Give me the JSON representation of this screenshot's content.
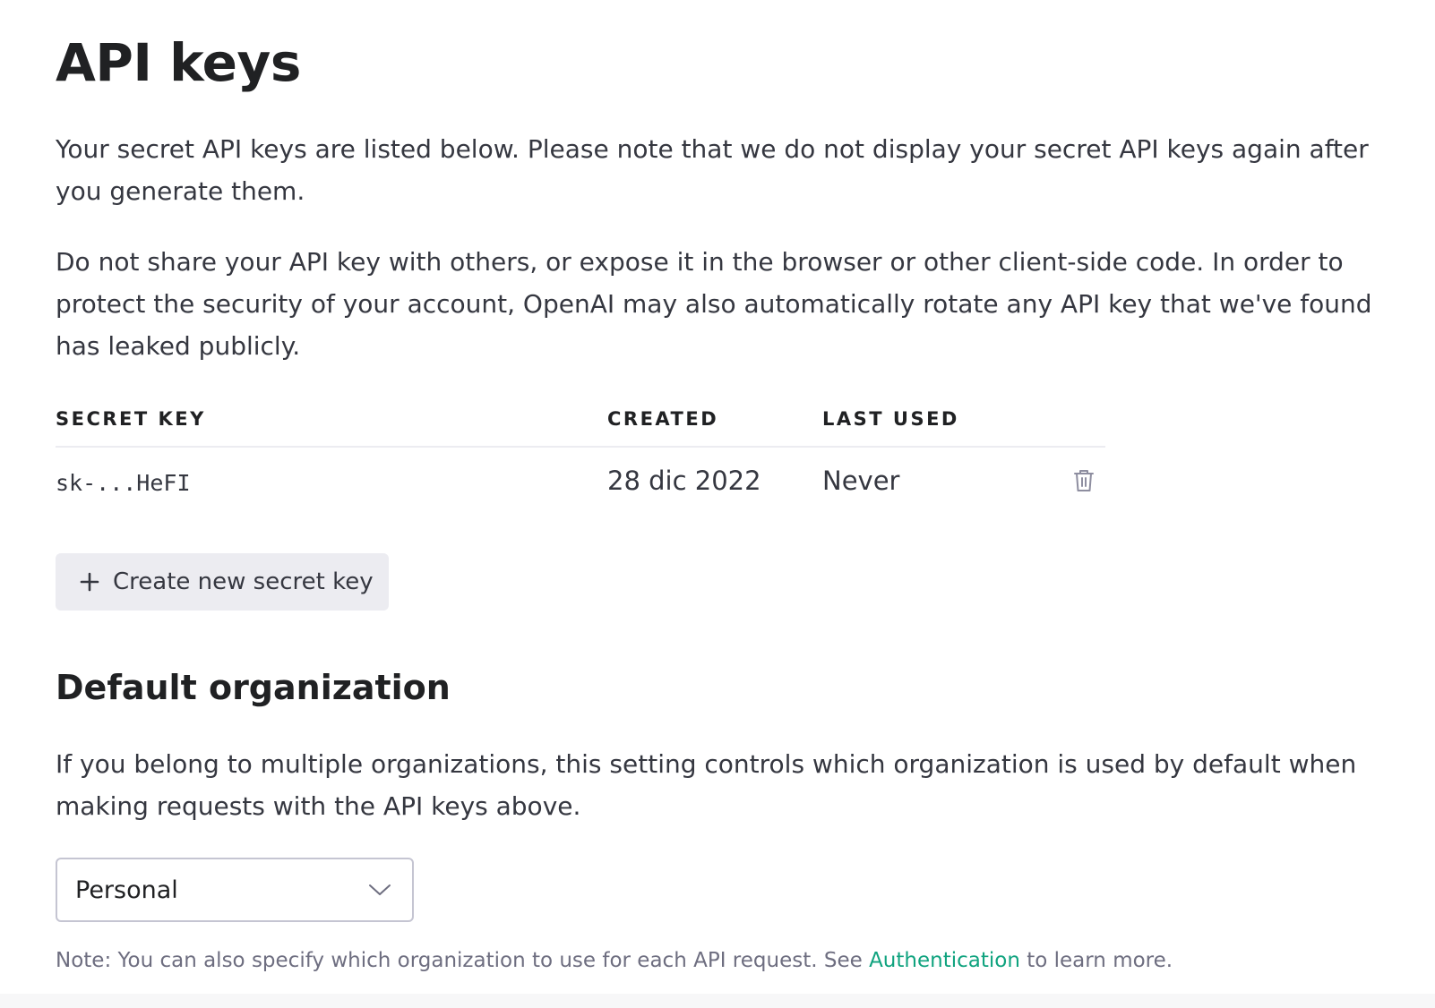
{
  "page": {
    "title": "API keys",
    "intro_paragraph": "Your secret API keys are listed below. Please note that we do not display your secret API keys again after you generate them.",
    "warning_paragraph": "Do not share your API key with others, or expose it in the browser or other client-side code. In order to protect the security of your account, OpenAI may also automatically rotate any API key that we've found has leaked publicly."
  },
  "keys_table": {
    "columns": {
      "secret_key": "SECRET KEY",
      "created": "CREATED",
      "last_used": "LAST USED"
    },
    "rows": [
      {
        "secret_key": "sk-...HeFI",
        "created": "28 dic 2022",
        "last_used": "Never",
        "delete_icon": "trash-icon"
      }
    ]
  },
  "create_button": {
    "icon": "plus-icon",
    "label": "Create new secret key"
  },
  "default_org": {
    "title": "Default organization",
    "description": "If you belong to multiple organizations, this setting controls which organization is used by default when making requests with the API keys above.",
    "select": {
      "selected": "Personal",
      "icon": "chevron-down-icon"
    },
    "note_prefix": "Note: You can also specify which organization to use for each API request. See ",
    "note_link": "Authentication",
    "note_suffix": " to learn more."
  },
  "colors": {
    "text": "#353740",
    "heading": "#202123",
    "muted": "#6e6e80",
    "link": "#10a37f",
    "button_bg": "#ececf1",
    "border": "#c5c5d2"
  }
}
